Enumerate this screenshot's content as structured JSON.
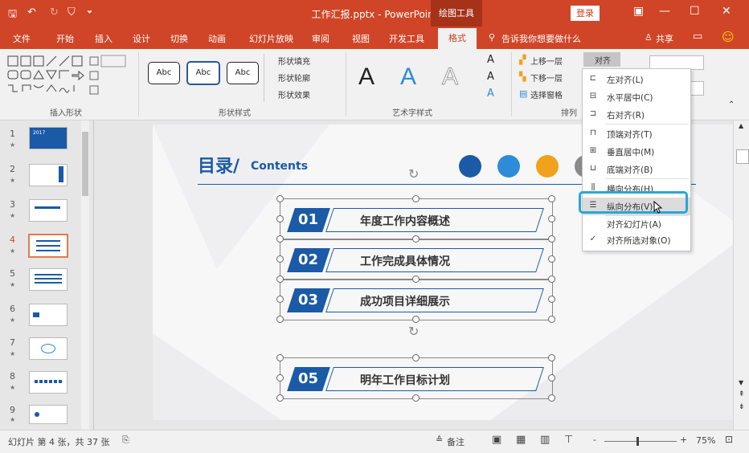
{
  "app": {
    "title": "工作汇报.pptx - PowerPoint",
    "context_tab_group": "绘图工具",
    "login": "登录",
    "qa_save": "🖫",
    "qa_undo": "↶",
    "qa_redo": "↻",
    "qa_start": "⛉",
    "qa_more": "⏷",
    "win_ribbon_opts": "▣",
    "win_min": "—",
    "win_max": "☐",
    "win_close": "✕"
  },
  "menu": {
    "items": [
      "文件",
      "开始",
      "插入",
      "设计",
      "切换",
      "动画",
      "幻灯片放映",
      "审阅",
      "视图",
      "开发工具"
    ],
    "active": "格式",
    "tell_me": "告诉我你想要做什么",
    "share": "共享",
    "comment": "▭",
    "smiley": "☺"
  },
  "ribbon": {
    "insert_shapes_label": "插入形状",
    "shape_styles_label": "形状样式",
    "wordart_label": "艺术字样式",
    "arrange_label": "排列",
    "abc": "Abc",
    "shape_fill": "形状填充",
    "shape_outline": "形状轮廓",
    "shape_effect": "形状效果",
    "bring_forward": "上移一层",
    "send_backward": "下移一层",
    "selection_pane": "选择窗格",
    "align": "对齐",
    "wordart_A": "A"
  },
  "thumbs": {
    "numbers": [
      "1",
      "2",
      "3",
      "4",
      "5",
      "6",
      "7",
      "8",
      "9"
    ],
    "star": "★",
    "selected_index": 4,
    "slide1_label": "2017"
  },
  "dropdown": {
    "items": [
      {
        "label": "左对齐(L)",
        "icon": "align-left-icon",
        "glyph": "⊏"
      },
      {
        "label": "水平居中(C)",
        "icon": "align-center-icon",
        "glyph": "⊟"
      },
      {
        "label": "右对齐(R)",
        "icon": "align-right-icon",
        "glyph": "⊐"
      },
      {
        "label": "顶端对齐(T)",
        "icon": "align-top-icon",
        "glyph": "⊓"
      },
      {
        "label": "垂直居中(M)",
        "icon": "align-middle-icon",
        "glyph": "⊞"
      },
      {
        "label": "底端对齐(B)",
        "icon": "align-bottom-icon",
        "glyph": "⊔"
      },
      {
        "label": "横向分布(H)",
        "icon": "distribute-horizontal-icon",
        "glyph": "⫼"
      },
      {
        "label": "纵向分布(V)",
        "icon": "distribute-vertical-icon",
        "glyph": "☰"
      },
      {
        "label": "对齐幻灯片(A)",
        "icon": "",
        "glyph": ""
      },
      {
        "label": "对齐所选对象(O)",
        "icon": "checkmark-icon",
        "glyph": "✓"
      }
    ],
    "highlighted": "纵向分布(V)"
  },
  "slide": {
    "title": "目录/",
    "title_en": "Contents",
    "rows": [
      {
        "num": "01",
        "text": "年度工作内容概述"
      },
      {
        "num": "02",
        "text": "工作完成具体情况"
      },
      {
        "num": "03",
        "text": "成功项目详细展示"
      },
      {
        "num": "05",
        "text": "明年工作目标计划"
      }
    ],
    "accent": "#1b5aa6",
    "icon_colors": [
      "#1b5aa6",
      "#2e8bd8",
      "#f0a21b",
      "#8a8a8a"
    ]
  },
  "status": {
    "slide_info": "幻灯片 第 4 张，共 37 张",
    "notes": "备注",
    "zoom": "75%",
    "plus": "+",
    "minus": "-"
  },
  "colors": {
    "ribbon_brand": "#d04527",
    "selection": "#27a7d8"
  }
}
